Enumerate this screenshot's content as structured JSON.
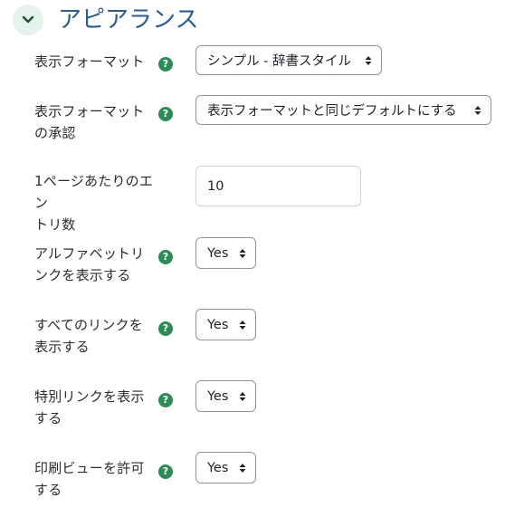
{
  "section": {
    "title": "アピアランス"
  },
  "fields": {
    "display_format": {
      "label": "表示フォーマット",
      "value": "シンプル - 辞書スタイル"
    },
    "approval_display_format": {
      "label_line1": "表示フォーマット",
      "label_line2": "の承認",
      "value": "表示フォーマットと同じデフォルトにする"
    },
    "entries_per_page": {
      "label_line1": "1ページあたりのエン",
      "label_line2": "トリ数",
      "value": "10"
    },
    "show_alphabet": {
      "label_line1": "アルファベットリ",
      "label_line2": "ンクを表示する",
      "value": "Yes"
    },
    "show_all": {
      "label_line1": "すべてのリンクを",
      "label_line2": "表示する",
      "value": "Yes"
    },
    "show_special": {
      "label_line1": "特別リンクを表示",
      "label_line2": "する",
      "value": "Yes"
    },
    "allow_print_view": {
      "label_line1": "印刷ビューを許可",
      "label_line2": "する",
      "value": "Yes"
    }
  },
  "help_icon": {
    "glyph": "?"
  },
  "colors": {
    "accent": "#2e8b57",
    "title": "#2b5e8f",
    "collapse_bg": "#e6f2ec"
  }
}
